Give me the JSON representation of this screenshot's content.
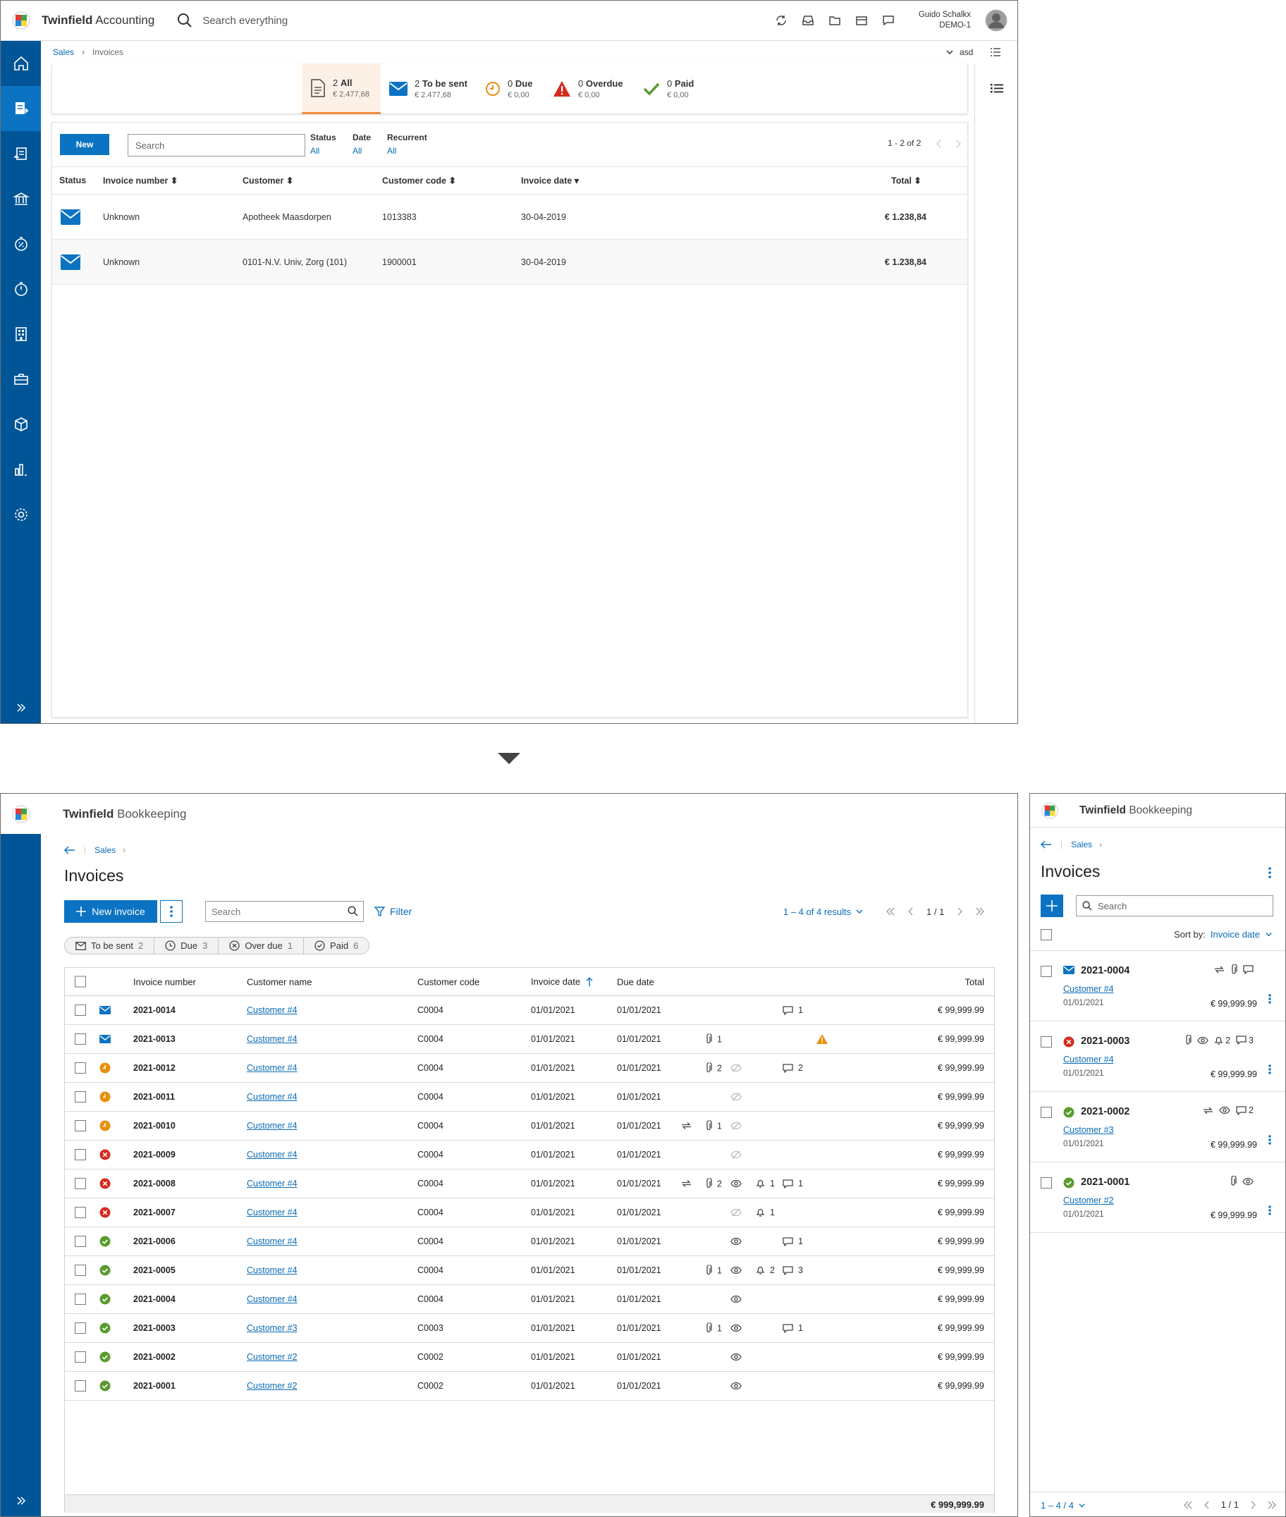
{
  "accounting": {
    "app_name": "Twinfield",
    "app_module": "Accounting",
    "search_placeholder": "Search everything",
    "user": {
      "name": "Guido Schalkx",
      "org": "DEMO-1"
    },
    "breadcrumb": [
      "Sales",
      "Invoices"
    ],
    "company": "asd",
    "cards": [
      {
        "count": "2",
        "label": "All",
        "amount": "€ 2.477,68"
      },
      {
        "count": "2",
        "label": "To be sent",
        "amount": "€ 2.477,68"
      },
      {
        "count": "0",
        "label": "Due",
        "amount": "€ 0,00"
      },
      {
        "count": "0",
        "label": "Overdue",
        "amount": "€ 0,00"
      },
      {
        "count": "0",
        "label": "Paid",
        "amount": "€ 0,00"
      }
    ],
    "new_label": "New",
    "search_placeholder_list": "Search",
    "filters": [
      {
        "label": "Status",
        "value": "All"
      },
      {
        "label": "Date",
        "value": "All"
      },
      {
        "label": "Recurrent",
        "value": "All"
      }
    ],
    "pagination": "1 - 2 of 2",
    "columns": [
      "Status",
      "Invoice number",
      "Customer",
      "Customer code",
      "Invoice date",
      "Total"
    ],
    "rows": [
      {
        "number": "Unknown",
        "customer": "Apotheek Maasdorpen",
        "code": "1013383",
        "date": "30-04-2019",
        "total": "€ 1.238,84"
      },
      {
        "number": "Unknown",
        "customer": "0101-N.V. Univ, Zorg (101)",
        "code": "1900001",
        "date": "30-04-2019",
        "total": "€ 1.238,84"
      }
    ]
  },
  "bookkeeping": {
    "app_name": "Twinfield",
    "app_module": "Bookkeeping",
    "breadcrumb": "Sales",
    "title": "Invoices",
    "new_invoice_label": "New invoice",
    "search_placeholder": "Search",
    "filter_label": "Filter",
    "results_label": "1 – 4 of 4 results",
    "page_label": "1 / 1",
    "chips": [
      {
        "label": "To be sent",
        "count": "2",
        "icon": "envelope-icon"
      },
      {
        "label": "Due",
        "count": "3",
        "icon": "clock-icon"
      },
      {
        "label": "Over due",
        "count": "1",
        "icon": "x-circle-icon"
      },
      {
        "label": "Paid",
        "count": "6",
        "icon": "check-circle-icon"
      }
    ],
    "columns": {
      "number": "Invoice number",
      "customer": "Customer name",
      "code": "Customer code",
      "date": "Invoice date",
      "due": "Due date",
      "total": "Total"
    },
    "status_colors": {
      "sent": "#0b73c2",
      "due": "#e8900c",
      "overdue": "#d52b1e",
      "paid": "#5a9b2e"
    },
    "rows": [
      {
        "status": "sent",
        "number": "2021-0014",
        "customer": "Customer #4",
        "code": "C0004",
        "date": "01/01/2021",
        "due": "01/01/2021",
        "recurring": false,
        "attach": "",
        "seen": "",
        "bell": "",
        "comment": "1",
        "warn": false,
        "total": "€ 99,999.99"
      },
      {
        "status": "sent",
        "number": "2021-0013",
        "customer": "Customer #4",
        "code": "C0004",
        "date": "01/01/2021",
        "due": "01/01/2021",
        "recurring": false,
        "attach": "1",
        "seen": "",
        "bell": "",
        "comment": "",
        "warn": true,
        "total": "€ 99,999.99"
      },
      {
        "status": "due",
        "number": "2021-0012",
        "customer": "Customer #4",
        "code": "C0004",
        "date": "01/01/2021",
        "due": "01/01/2021",
        "recurring": false,
        "attach": "2",
        "seen": "hidden",
        "bell": "",
        "comment": "2",
        "warn": false,
        "total": "€ 99,999.99"
      },
      {
        "status": "due",
        "number": "2021-0011",
        "customer": "Customer #4",
        "code": "C0004",
        "date": "01/01/2021",
        "due": "01/01/2021",
        "recurring": false,
        "attach": "",
        "seen": "hidden",
        "bell": "",
        "comment": "",
        "warn": false,
        "total": "€ 99,999.99"
      },
      {
        "status": "due",
        "number": "2021-0010",
        "customer": "Customer #4",
        "code": "C0004",
        "date": "01/01/2021",
        "due": "01/01/2021",
        "recurring": true,
        "attach": "1",
        "seen": "hidden",
        "bell": "",
        "comment": "",
        "warn": false,
        "total": "€ 99,999.99"
      },
      {
        "status": "overdue",
        "number": "2021-0009",
        "customer": "Customer #4",
        "code": "C0004",
        "date": "01/01/2021",
        "due": "01/01/2021",
        "recurring": false,
        "attach": "",
        "seen": "hidden",
        "bell": "",
        "comment": "",
        "warn": false,
        "total": "€ 99,999.99"
      },
      {
        "status": "overdue",
        "number": "2021-0008",
        "customer": "Customer #4",
        "code": "C0004",
        "date": "01/01/2021",
        "due": "01/01/2021",
        "recurring": true,
        "attach": "2",
        "seen": "seen",
        "bell": "1",
        "comment": "1",
        "warn": false,
        "total": "€ 99,999.99"
      },
      {
        "status": "overdue",
        "number": "2021-0007",
        "customer": "Customer #4",
        "code": "C0004",
        "date": "01/01/2021",
        "due": "01/01/2021",
        "recurring": false,
        "attach": "",
        "seen": "hidden",
        "bell": "1",
        "comment": "",
        "warn": false,
        "total": "€ 99,999.99"
      },
      {
        "status": "paid",
        "number": "2021-0006",
        "customer": "Customer #4",
        "code": "C0004",
        "date": "01/01/2021",
        "due": "01/01/2021",
        "recurring": false,
        "attach": "",
        "seen": "seen",
        "bell": "",
        "comment": "1",
        "warn": false,
        "total": "€ 99,999.99"
      },
      {
        "status": "paid",
        "number": "2021-0005",
        "customer": "Customer #4",
        "code": "C0004",
        "date": "01/01/2021",
        "due": "01/01/2021",
        "recurring": false,
        "attach": "1",
        "seen": "seen",
        "bell": "2",
        "comment": "3",
        "warn": false,
        "total": "€ 99,999.99"
      },
      {
        "status": "paid",
        "number": "2021-0004",
        "customer": "Customer #4",
        "code": "C0004",
        "date": "01/01/2021",
        "due": "01/01/2021",
        "recurring": false,
        "attach": "",
        "seen": "seen",
        "bell": "",
        "comment": "",
        "warn": false,
        "total": "€ 99,999.99"
      },
      {
        "status": "paid",
        "number": "2021-0003",
        "customer": "Customer #3",
        "code": "C0003",
        "date": "01/01/2021",
        "due": "01/01/2021",
        "recurring": false,
        "attach": "1",
        "seen": "seen",
        "bell": "",
        "comment": "1",
        "warn": false,
        "total": "€ 99,999.99"
      },
      {
        "status": "paid",
        "number": "2021-0002",
        "customer": "Customer #2",
        "code": "C0002",
        "date": "01/01/2021",
        "due": "01/01/2021",
        "recurring": false,
        "attach": "",
        "seen": "seen",
        "bell": "",
        "comment": "",
        "warn": false,
        "total": "€ 99,999.99"
      },
      {
        "status": "paid",
        "number": "2021-0001",
        "customer": "Customer #2",
        "code": "C0002",
        "date": "01/01/2021",
        "due": "01/01/2021",
        "recurring": false,
        "attach": "",
        "seen": "seen",
        "bell": "",
        "comment": "",
        "warn": false,
        "total": "€ 99,999.99"
      }
    ],
    "grand_total": "€ 999,999.99"
  },
  "mobile": {
    "app_name": "Twinfield",
    "app_module": "Bookkeeping",
    "breadcrumb": "Sales",
    "title": "Invoices",
    "search_placeholder": "Search",
    "sort_label": "Sort by:",
    "sort_value": "Invoice date",
    "items": [
      {
        "status": "sent",
        "number": "2021-0004",
        "customer": "Customer #4",
        "date": "01/01/2021",
        "total": "€ 99,999.99",
        "recurring": true,
        "attach": true,
        "seen": false,
        "bell": "",
        "comment": ""
      },
      {
        "status": "overdue",
        "number": "2021-0003",
        "customer": "Customer #4",
        "date": "01/01/2021",
        "total": "€ 99,999.99",
        "recurring": false,
        "attach": true,
        "seen": true,
        "bell": "2",
        "comment": "3"
      },
      {
        "status": "paid",
        "number": "2021-0002",
        "customer": "Customer #3",
        "date": "01/01/2021",
        "total": "€ 99,999.99",
        "recurring": true,
        "attach": false,
        "seen": true,
        "bell": "",
        "comment": "2"
      },
      {
        "status": "paid",
        "number": "2021-0001",
        "customer": "Customer #2",
        "date": "01/01/2021",
        "total": "€ 99,999.99",
        "recurring": false,
        "attach": true,
        "seen": true,
        "bell": "",
        "comment": ""
      }
    ],
    "results_label": "1 – 4 / 4",
    "page_label": "1 / 1"
  }
}
